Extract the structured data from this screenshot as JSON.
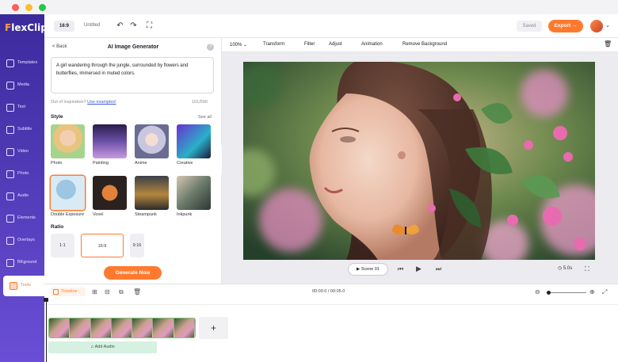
{
  "app": {
    "logo_prefix": "F",
    "logo_rest": "lexClip"
  },
  "topbar": {
    "ratio": "16:9",
    "project_name": "Untitled",
    "saved": "Saved",
    "export": "Export →"
  },
  "sidebar": {
    "items": [
      {
        "label": "Templates"
      },
      {
        "label": "Media"
      },
      {
        "label": "Text"
      },
      {
        "label": "Subtitle"
      },
      {
        "label": "Video"
      },
      {
        "label": "Photo"
      },
      {
        "label": "Audio"
      },
      {
        "label": "Elements"
      },
      {
        "label": "Overlays"
      },
      {
        "label": "BKground"
      },
      {
        "label": "Tools"
      }
    ]
  },
  "panel": {
    "back": "< Back",
    "title": "AI Image Generator",
    "prompt": "A girl wandering through the jungle, surrounded by flowers and butterflies, immersed in muted colors.",
    "inspiration": "Out of inspiration?",
    "examples_link": "Use examples!",
    "counter": "101/500",
    "style_heading": "Style",
    "see_all": "See all",
    "styles": [
      {
        "label": "Photo"
      },
      {
        "label": "Painting"
      },
      {
        "label": "Anime"
      },
      {
        "label": "Creative"
      },
      {
        "label": "Double Exposure"
      },
      {
        "label": "Voxel"
      },
      {
        "label": "Steampunk"
      },
      {
        "label": "Inkpunk"
      }
    ],
    "ratio_heading": "Ratio",
    "ratios": [
      "1:1",
      "16:9",
      "9:16"
    ],
    "generate": "Generate Now"
  },
  "editor": {
    "zoom": "100%",
    "tools": [
      "Transform",
      "Filter",
      "Adjust",
      "Animation",
      "Remove Background"
    ]
  },
  "player": {
    "scene": "Scene 01",
    "duration": "5.0s"
  },
  "timeline": {
    "label": "Timeline",
    "time": "00:00.0 / 00:05.0",
    "add_audio": "Add Audio"
  }
}
